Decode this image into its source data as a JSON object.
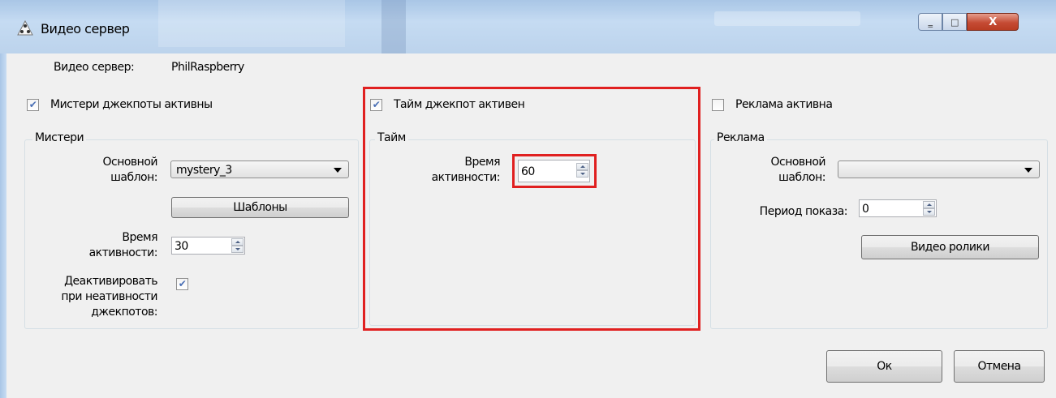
{
  "window": {
    "title": "Видео сервер",
    "controls": {
      "minimize": "‗",
      "maximize": "□",
      "close": "X"
    }
  },
  "server": {
    "label": "Видео сервер:",
    "value": "PhilRaspberry"
  },
  "mystery": {
    "checkbox_label": "Мистери джекпоты активны",
    "checked": true,
    "group_title": "Мистери",
    "template_label_1": "Основной",
    "template_label_2": "шаблон:",
    "template_value": "mystery_3",
    "templates_button": "Шаблоны",
    "time_label_1": "Время",
    "time_label_2": "активности:",
    "time_value": "30",
    "deactivate_label_1": "Деактивировать",
    "deactivate_label_2": "при неативности",
    "deactivate_label_3": "джекпотов:",
    "deactivate_checked": true
  },
  "time_jackpot": {
    "checkbox_label": "Тайм джекпот активен",
    "checked": true,
    "group_title": "Тайм",
    "time_label_1": "Время",
    "time_label_2": "активности:",
    "time_value": "60"
  },
  "ads": {
    "checkbox_label": "Реклама активна",
    "checked": false,
    "group_title": "Реклама",
    "template_label_1": "Основной",
    "template_label_2": "шаблон:",
    "template_value": "",
    "period_label": "Период показа:",
    "period_value": "0",
    "videos_button": "Видео ролики"
  },
  "footer": {
    "ok": "Ок",
    "cancel": "Отмена"
  },
  "colors": {
    "highlight": "#e02020",
    "check": "#4a6fb5"
  }
}
